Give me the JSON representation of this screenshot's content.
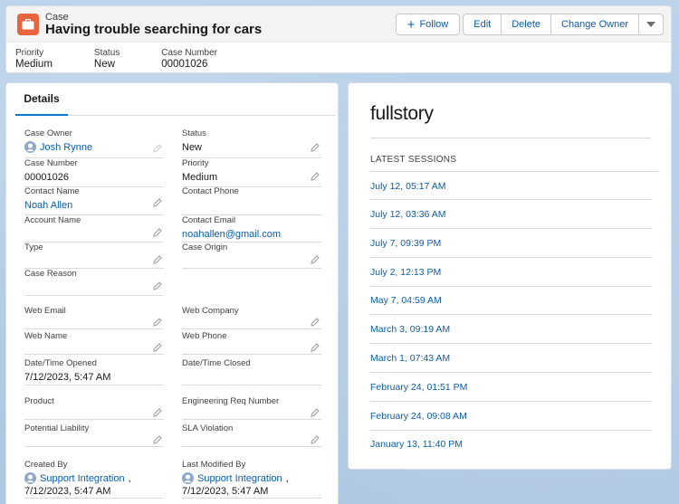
{
  "record": {
    "object_label": "Case",
    "title": "Having trouble searching for cars",
    "brand_color": "#E9653F"
  },
  "actions": {
    "follow": "Follow",
    "edit": "Edit",
    "delete": "Delete",
    "change_owner": "Change Owner"
  },
  "highlights": [
    {
      "label": "Priority",
      "value": "Medium"
    },
    {
      "label": "Status",
      "value": "New"
    },
    {
      "label": "Case Number",
      "value": "00001026"
    }
  ],
  "details": {
    "tab_label": "Details",
    "case_owner": {
      "label": "Case Owner",
      "value": "Josh Rynne"
    },
    "status": {
      "label": "Status",
      "value": "New"
    },
    "case_number": {
      "label": "Case Number",
      "value": "00001026"
    },
    "priority": {
      "label": "Priority",
      "value": "Medium"
    },
    "contact_name": {
      "label": "Contact Name",
      "value": "Noah Allen"
    },
    "contact_phone": {
      "label": "Contact Phone",
      "value": ""
    },
    "account_name": {
      "label": "Account Name",
      "value": ""
    },
    "contact_email": {
      "label": "Contact Email",
      "value": "noahallen@gmail.com"
    },
    "type": {
      "label": "Type",
      "value": ""
    },
    "case_origin": {
      "label": "Case Origin",
      "value": ""
    },
    "case_reason": {
      "label": "Case Reason",
      "value": ""
    },
    "web_email": {
      "label": "Web Email",
      "value": ""
    },
    "web_company": {
      "label": "Web Company",
      "value": ""
    },
    "web_name": {
      "label": "Web Name",
      "value": ""
    },
    "web_phone": {
      "label": "Web Phone",
      "value": ""
    },
    "date_opened": {
      "label": "Date/Time Opened",
      "value": "7/12/2023, 5:47 AM"
    },
    "date_closed": {
      "label": "Date/Time Closed",
      "value": ""
    },
    "product": {
      "label": "Product",
      "value": ""
    },
    "eng_req": {
      "label": "Engineering Req Number",
      "value": ""
    },
    "potential_liability": {
      "label": "Potential Liability",
      "value": ""
    },
    "sla_violation": {
      "label": "SLA Violation",
      "value": ""
    },
    "created_by": {
      "label": "Created By",
      "user": "Support Integration",
      "date": "7/12/2023, 5:47 AM"
    },
    "last_modified_by": {
      "label": "Last Modified By",
      "user": "Support Integration",
      "date": "7/12/2023, 5:47 AM"
    }
  },
  "fullstory": {
    "logo": "fullstory",
    "heading": "LATEST SESSIONS",
    "sessions": [
      "July 12, 05:17 AM",
      "July 12, 03:36 AM",
      "July 7, 09:39 PM",
      "July 2, 12:13 PM",
      "May 7, 04:59 AM",
      "March 3, 09:19 AM",
      "March 1, 07:43 AM",
      "February 24, 01:51 PM",
      "February 24, 09:08 AM",
      "January 13, 11:40 PM"
    ]
  },
  "colors": {
    "link": "#0B5CAB",
    "tab_active": "#0176D3",
    "background": "#B8CFE6"
  }
}
